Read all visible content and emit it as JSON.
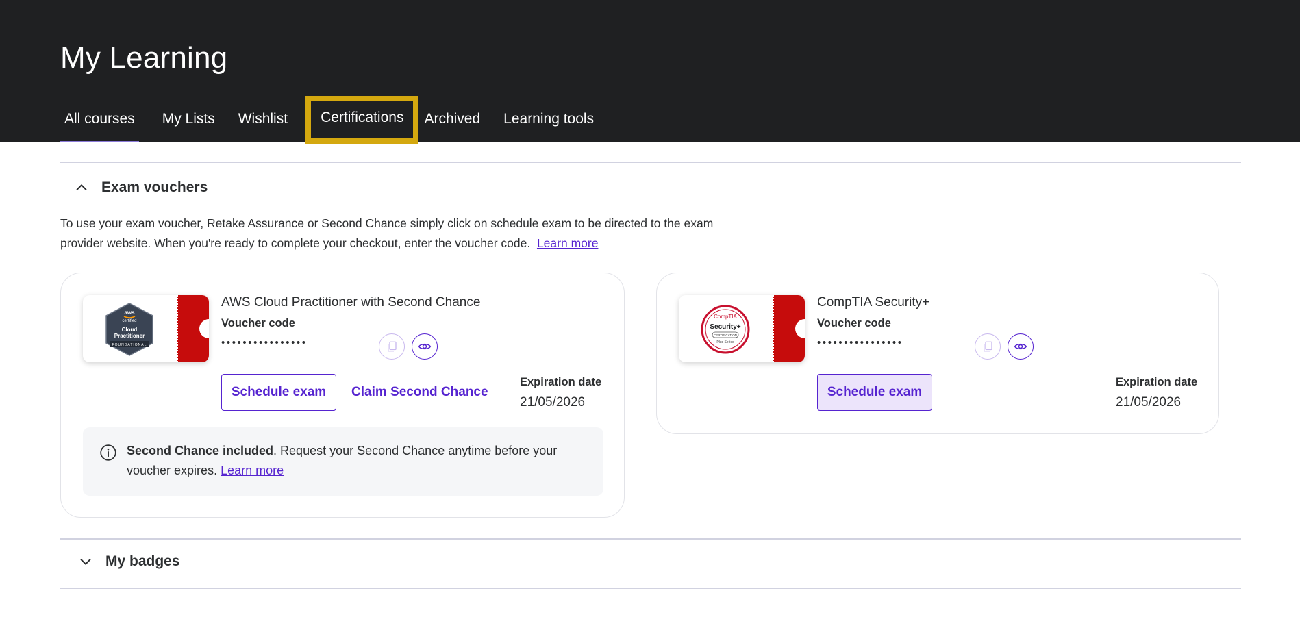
{
  "header": {
    "title": "My Learning",
    "tabs": [
      {
        "label": "All courses"
      },
      {
        "label": "My Lists"
      },
      {
        "label": "Wishlist"
      },
      {
        "label": "Certifications"
      },
      {
        "label": "Archived"
      },
      {
        "label": "Learning tools"
      }
    ]
  },
  "exam_vouchers": {
    "title": "Exam vouchers",
    "intro_text": "To use your exam voucher, Retake Assurance or Second Chance simply click on schedule exam to be directed to the exam provider website. When you're ready to complete your checkout, enter the voucher code.",
    "intro_link": "Learn more",
    "vouchers": [
      {
        "title": "AWS Cloud Practitioner with Second Chance",
        "code_label": "Voucher code",
        "code_masked": "••••••••••••••••",
        "badge_text": {
          "top": "aws",
          "certified": "certified",
          "name1": "Cloud",
          "name2": "Practitioner",
          "level": "FOUNDATIONAL"
        },
        "schedule_label": "Schedule exam",
        "secondary_label": "Claim Second Chance",
        "expiration_label": "Expiration date",
        "expiration_date": "21/05/2026",
        "info_bold": "Second Chance included",
        "info_text": ". Request your Second Chance anytime before your voucher expires.",
        "info_link": "Learn more"
      },
      {
        "title": "CompTIA Security+",
        "code_label": "Voucher code",
        "code_masked": "••••••••••••••••",
        "badge_text": {
          "brand": "CompTIA",
          "name": "Security+",
          "cert": "CERTIFICATION",
          "series": "Plus Series"
        },
        "schedule_label": "Schedule exam",
        "expiration_label": "Expiration date",
        "expiration_date": "21/05/2026"
      }
    ]
  },
  "my_badges": {
    "title": "My badges"
  },
  "colors": {
    "header_bg": "#1f2022",
    "accent_purple": "#5624d0",
    "highlight_yellow": "#d4a80f",
    "ticket_red": "#c60c0c"
  }
}
